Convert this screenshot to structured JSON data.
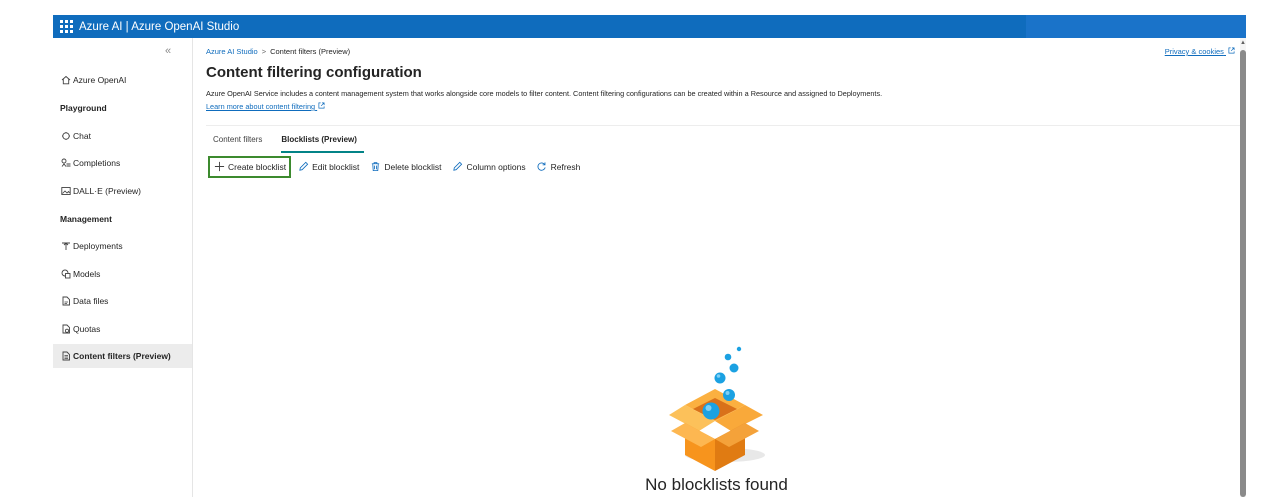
{
  "topbar": {
    "title": "Azure AI  |  Azure OpenAI Studio",
    "waffle_icon": "waffle-icon"
  },
  "sidebar": {
    "collapse_glyph": "«",
    "items": [
      {
        "label": "Azure OpenAI",
        "icon": "home-icon"
      },
      {
        "label": "Chat",
        "icon": "chat-icon"
      },
      {
        "label": "Completions",
        "icon": "completions-icon"
      },
      {
        "label": "DALL·E (Preview)",
        "icon": "image-icon"
      },
      {
        "label": "Deployments",
        "icon": "deployments-icon"
      },
      {
        "label": "Models",
        "icon": "models-icon"
      },
      {
        "label": "Data files",
        "icon": "data-file-icon"
      },
      {
        "label": "Quotas",
        "icon": "quotas-icon"
      },
      {
        "label": "Content filters (Preview)",
        "icon": "content-filter-icon"
      }
    ],
    "sections": {
      "playground": "Playground",
      "management": "Management"
    }
  },
  "breadcrumb": {
    "root": "Azure AI Studio",
    "separator": ">",
    "current": "Content filters (Preview)"
  },
  "privacy_link": "Privacy & cookies",
  "page": {
    "title": "Content filtering configuration",
    "description": "Azure OpenAI Service includes a content management system that works alongside core models to filter content. Content filtering configurations can be created within a Resource and assigned to Deployments.",
    "learn_more": "Learn more about content filtering"
  },
  "tabs": [
    {
      "label": "Content filters"
    },
    {
      "label": "Blocklists (Preview)"
    }
  ],
  "toolbar": {
    "create": "Create blocklist",
    "edit": "Edit blocklist",
    "delete": "Delete blocklist",
    "columns": "Column options",
    "refresh": "Refresh"
  },
  "empty_state": {
    "message": "No blocklists found"
  },
  "colors": {
    "topbar": "#0f6cbd",
    "link": "#0f6cbd",
    "tab_underline": "#038387",
    "highlight_border": "#3c8a2e",
    "box_orange": "#f7941d",
    "bubble_blue": "#1ba1e2"
  }
}
